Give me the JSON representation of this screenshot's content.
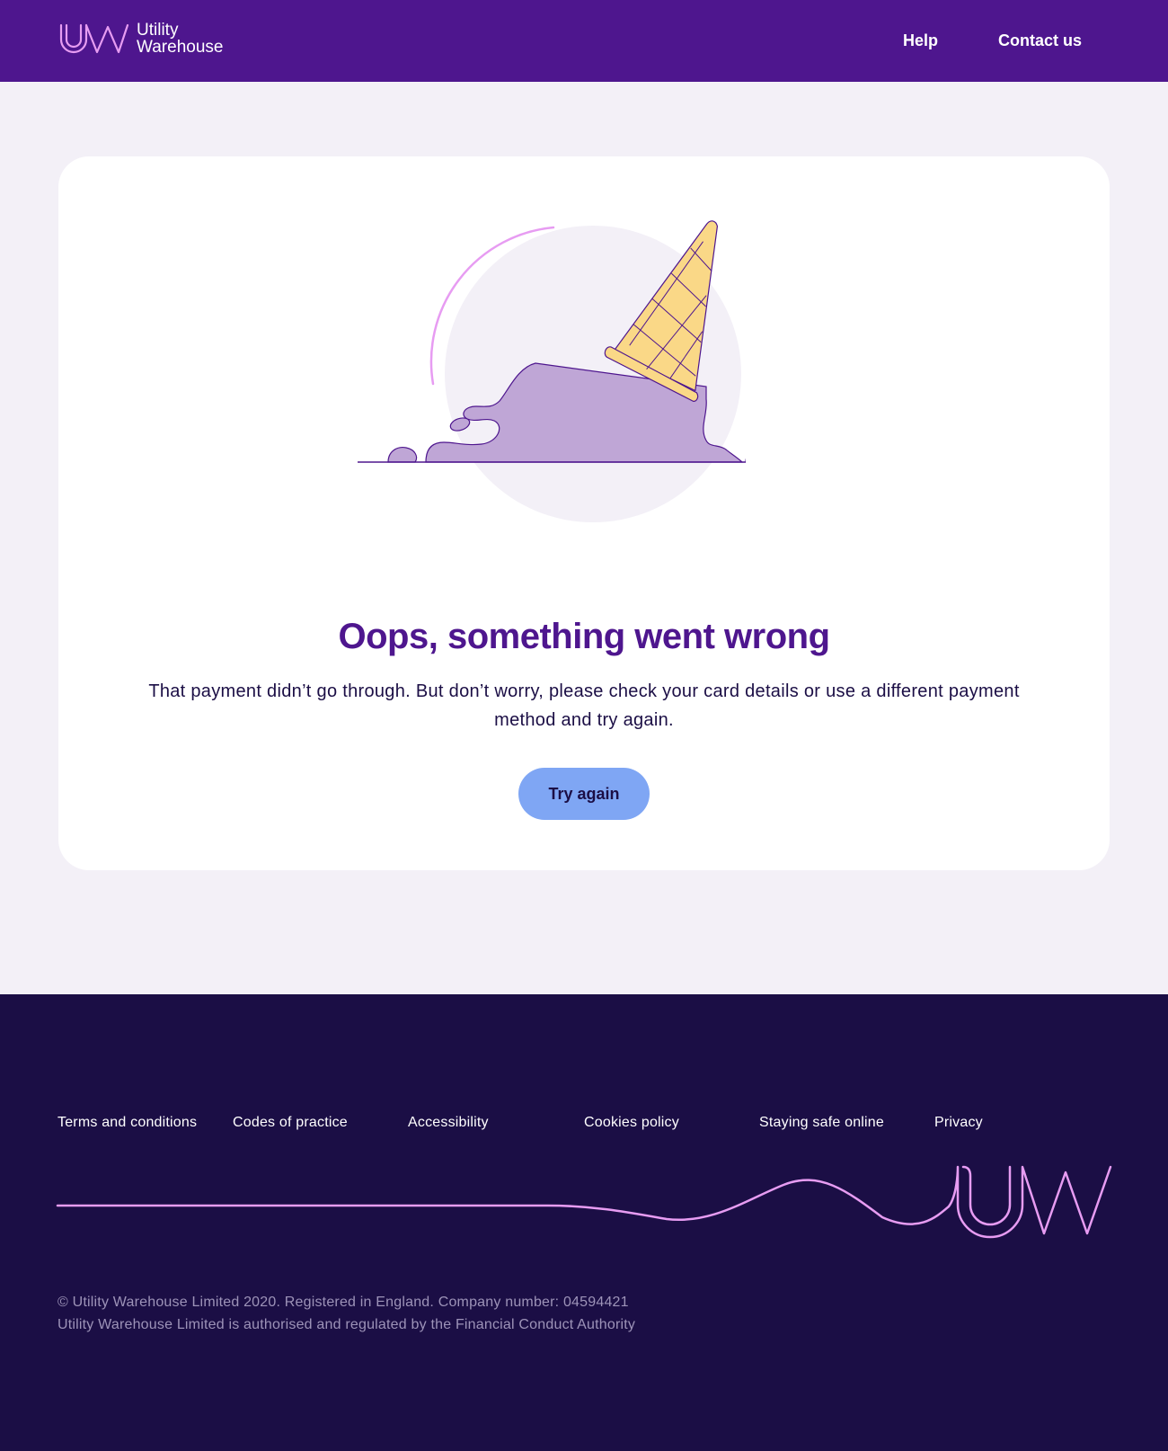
{
  "header": {
    "brand_line1": "Utility",
    "brand_line2": "Warehouse",
    "nav": [
      {
        "label": "Help"
      },
      {
        "label": "Contact us"
      }
    ]
  },
  "error": {
    "title": "Oops, something went wrong",
    "message": "That payment didn’t go through. But don’t worry, please check your card details or use a different payment method and try again.",
    "button_label": "Try again",
    "illustration_icon": "melted-ice-cream-cone"
  },
  "footer": {
    "links": [
      {
        "label": "Terms and conditions"
      },
      {
        "label": "Codes of practice"
      },
      {
        "label": "Accessibility"
      },
      {
        "label": "Cookies policy"
      },
      {
        "label": "Staying safe online"
      },
      {
        "label": "Privacy"
      }
    ],
    "legal_line1": "© Utility Warehouse Limited 2020. Registered in England. Company number: 04594421",
    "legal_line2": "Utility Warehouse Limited is authorised and regulated by the Financial Conduct Authority"
  },
  "colors": {
    "brand_purple": "#4e168e",
    "footer_navy": "#1b0e45",
    "page_background": "#f3f0f7",
    "button_blue": "#7fa6f4",
    "accent_pink": "#e79cf2",
    "cone_yellow": "#fad887",
    "ice_cream_lilac": "#bfa6d6"
  }
}
